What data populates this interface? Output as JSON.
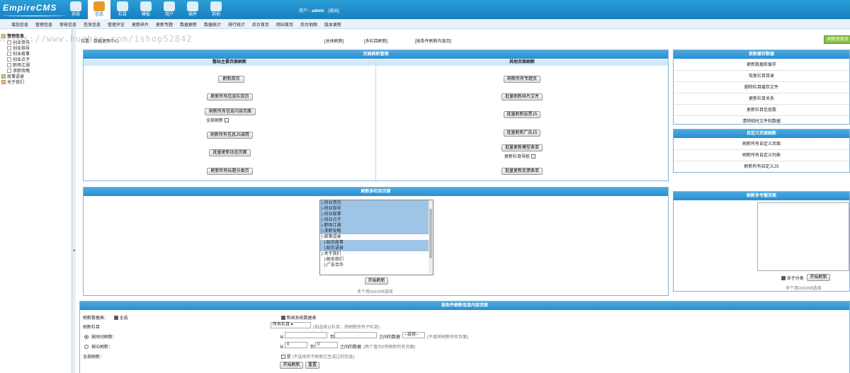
{
  "header": {
    "logo": "EmpireCMS",
    "nav": [
      {
        "label": "系统",
        "icon": "system-icon"
      },
      {
        "label": "信息",
        "icon": "info-icon"
      },
      {
        "label": "栏目",
        "icon": "folder-icon"
      },
      {
        "label": "模板",
        "icon": "template-icon"
      },
      {
        "label": "用户",
        "icon": "user-icon"
      },
      {
        "label": "插件",
        "icon": "plugin-icon"
      },
      {
        "label": "其他",
        "icon": "gear-icon"
      }
    ],
    "user_prefix": "用户：",
    "username": "admin",
    "logout": "[退出]"
  },
  "subnav": [
    "增加信息",
    "管理信息",
    "审核信息",
    "签发信息",
    "管理评论",
    "更新碎片",
    "更新专题",
    "数据更新",
    "数据统计",
    "排行统计",
    "后台首页",
    "网站首页",
    "后台地图",
    "版本更新"
  ],
  "tree": {
    "root": "管理信息",
    "items": [
      "创业资讯",
      "创业指导",
      "创业故事",
      "创业点子",
      "职场江湖",
      "求职攻略"
    ],
    "folders": [
      "故事语录",
      "关于我们"
    ]
  },
  "toprow": {
    "location": "位置：数据更新中心",
    "all_refresh": "[总体刷新]",
    "multi_refresh": "[多栏目刷新]",
    "cond_refresh": "[按条件刷新内容页]",
    "green_button": "刷新信息页"
  },
  "watermark": "https://www.huzhan.com/ishop52842",
  "page_refresh": {
    "title": "页面刷新管理",
    "left_header": "整站主要页面刷新",
    "right_header": "其他页面刷新",
    "left_buttons": [
      "刷新首页",
      "刷新所有信息栏目页",
      "刷新所有信息内容页面",
      "刷新所有信息JS调用",
      "批量更新动态页面",
      "刷新所有标题分类页"
    ],
    "full_refresh_label": "全部刷新",
    "right_buttons": [
      "刷新所有专题页",
      "批量刷新碎片文件",
      "批量刷新投票JS",
      "批量刷新广告JS",
      "批量更新模型表单",
      "批量更新反馈表单"
    ],
    "nav_update_label": "更新栏目导航"
  },
  "cache_panel": {
    "title": "更新缓存数据",
    "items": [
      "更新数据库缓存",
      "恢复栏目目录",
      "删除栏目缓存文件",
      "更新栏目关系",
      "更新栏目信息数",
      "清除临时文件和数据"
    ]
  },
  "custom_panel": {
    "title": "自定义页面刷新",
    "items": [
      "刷新所有自定义页面",
      "刷新所有自定义列表",
      "刷新所有自定义JS"
    ]
  },
  "multi_panel": {
    "title": "刷新多栏目页面",
    "options": [
      {
        "text": "|-创业资讯",
        "selected": true
      },
      {
        "text": "|-创业指导",
        "selected": true
      },
      {
        "text": "|-创业故事",
        "selected": true
      },
      {
        "text": "|-创业点子",
        "selected": true
      },
      {
        "text": "|-职场江湖",
        "selected": true
      },
      {
        "text": "|-求职攻略",
        "selected": true
      },
      {
        "text": "|-故事语录",
        "selected": false
      },
      {
        "text": "  |-励志故事",
        "selected": true
      },
      {
        "text": "  |-励志语录",
        "selected": true
      },
      {
        "text": "|-关于我们",
        "selected": false
      },
      {
        "text": "  |-联系我们",
        "selected": false
      },
      {
        "text": "  |-广告合作",
        "selected": false
      }
    ],
    "start_button": "开始刷新",
    "hint": "多个用ctrl/shift选择"
  },
  "topic_panel": {
    "title": "刷新多专题页面",
    "include_child": "含子分类",
    "start_button": "开始刷新",
    "hint": "多个用ctrl/shift选择"
  },
  "cond_panel": {
    "title": "按条件刷新信息内容页面",
    "table_label": "刷新数据表：",
    "select_all": "全选",
    "table_news": "新闻系统数据表",
    "column_label": "刷新栏目",
    "column_select": "所有栏目",
    "column_hint": "(如选择父栏目，将刷新所有子栏目)",
    "by_time": "按时间刷新：",
    "from": "从",
    "to": "到",
    "between_data": "之间的数据",
    "choose": "--选择--",
    "by_time_hint": "(不填将刷新所有页面)",
    "by_id": "按ID刷新：",
    "from_id": "0",
    "to_id": "0",
    "between_data_id": "之间的数据",
    "by_id_hint": "(两个值为0将刷新所有页面)",
    "all_refresh": "全部刷新：",
    "yes": "是",
    "all_hint": "(不选择将不刷新已生成过的信息)",
    "start_button": "开始刷新",
    "reset_button": "重置"
  }
}
